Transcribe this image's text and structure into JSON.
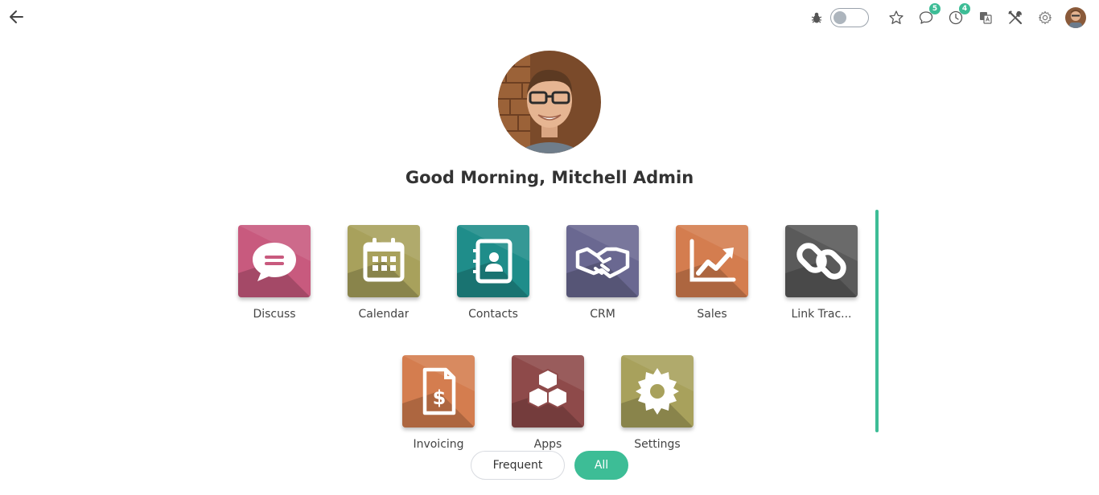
{
  "topbar": {
    "back_icon": "arrow-left-icon",
    "debug_icon": "bug-icon",
    "favorites_icon": "star-icon",
    "messages_icon": "chat-icon",
    "messages_count": "5",
    "activities_icon": "clock-icon",
    "activities_count": "4",
    "language_icon": "translate-icon",
    "tools_icon": "tools-icon",
    "settings_icon": "gear-icon",
    "accent_color": "#3dbd96"
  },
  "greeting": "Good Morning, Mitchell Admin",
  "apps": [
    {
      "label": "Discuss",
      "icon": "chat-bubble-icon",
      "color": "#c85a7e"
    },
    {
      "label": "Calendar",
      "icon": "calendar-icon",
      "color": "#a8a15c"
    },
    {
      "label": "Contacts",
      "icon": "address-book-icon",
      "color": "#1f8d8a"
    },
    {
      "label": "CRM",
      "icon": "handshake-icon",
      "color": "#6a6891"
    },
    {
      "label": "Sales",
      "icon": "trend-up-icon",
      "color": "#d47d4f"
    },
    {
      "label": "Link Trac...",
      "icon": "link-icon",
      "color": "#5a5a5a"
    },
    {
      "label": "Invoicing",
      "icon": "invoice-icon",
      "color": "#d47d4f"
    },
    {
      "label": "Apps",
      "icon": "cubes-icon",
      "color": "#8e4a4a"
    },
    {
      "label": "Settings",
      "icon": "gear-icon",
      "color": "#a8a15c"
    }
  ],
  "filters": {
    "frequent_label": "Frequent",
    "all_label": "All"
  }
}
